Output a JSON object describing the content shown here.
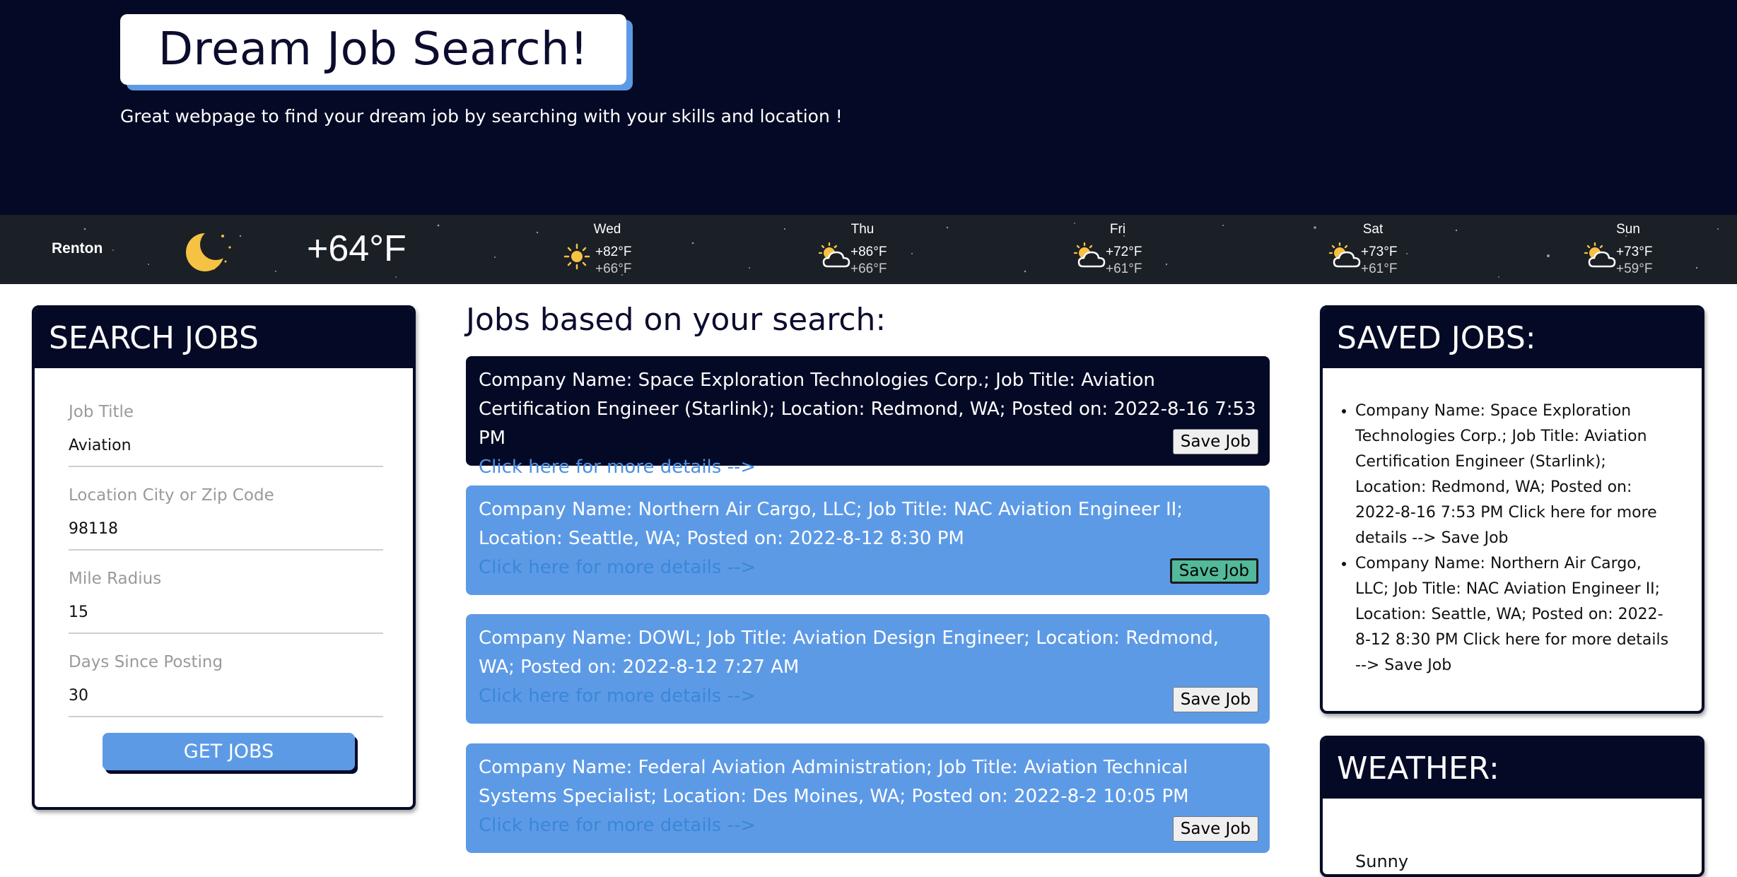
{
  "header": {
    "title": "Dream Job Search!",
    "subtitle": "Great webpage to find your dream job by searching with your skills and location !"
  },
  "weather_strip": {
    "city": "Renton",
    "current_icon": "moon-night-icon",
    "current_temp": "+64°F",
    "forecast": [
      {
        "day": "Wed",
        "icon": "sun-icon",
        "high": "+82°F",
        "low": "+66°F"
      },
      {
        "day": "Thu",
        "icon": "partly-cloudy-icon",
        "high": "+86°F",
        "low": "+66°F"
      },
      {
        "day": "Fri",
        "icon": "partly-cloudy-icon",
        "high": "+72°F",
        "low": "+61°F"
      },
      {
        "day": "Sat",
        "icon": "partly-cloudy-icon",
        "high": "+73°F",
        "low": "+61°F"
      },
      {
        "day": "Sun",
        "icon": "partly-cloudy-icon",
        "high": "+73°F",
        "low": "+59°F"
      }
    ]
  },
  "search": {
    "heading": "SEARCH JOBS",
    "fields": [
      {
        "label": "Job Title",
        "value": "Aviation"
      },
      {
        "label": "Location City or Zip Code",
        "value": "98118"
      },
      {
        "label": "Mile Radius",
        "value": "15"
      },
      {
        "label": "Days Since Posting",
        "value": "30"
      }
    ],
    "button": "GET JOBS"
  },
  "jobs": {
    "heading": "Jobs based on your search:",
    "link_text": "Click here for more details -->",
    "save_label": "Save Job",
    "items": [
      {
        "text": "Company Name: Space Exploration Technologies Corp.; Job Title: Aviation Certification Engineer (Starlink); Location: Redmond, WA; Posted on: 2022-8-16 7:53 PM"
      },
      {
        "text": "Company Name: Northern Air Cargo, LLC; Job Title: NAC Aviation Engineer II; Location: Seattle, WA; Posted on: 2022-8-12 8:30 PM"
      },
      {
        "text": "Company Name: DOWL; Job Title: Aviation Design Engineer; Location: Redmond, WA; Posted on: 2022-8-12 7:27 AM"
      },
      {
        "text": "Company Name: Federal Aviation Administration; Job Title: Aviation Technical Systems Specialist; Location: Des Moines, WA; Posted on: 2022-8-2 10:05 PM"
      }
    ]
  },
  "saved": {
    "heading": "SAVED JOBS:",
    "items": [
      "Company Name: Space Exploration Technologies Corp.; Job Title: Aviation Certification Engineer (Starlink); Location: Redmond, WA; Posted on: 2022-8-16 7:53 PM Click here for more details --> Save Job",
      "Company Name: Northern Air Cargo, LLC; Job Title: NAC Aviation Engineer II; Location: Seattle, WA; Posted on: 2022-8-12 8:30 PM Click here for more details --> Save Job"
    ]
  },
  "weather_panel": {
    "heading": "WEATHER:",
    "description": "Sunny"
  },
  "colors": {
    "navy": "#040a25",
    "accent_blue": "#5d9ae6",
    "hover_green": "#52b99a"
  }
}
